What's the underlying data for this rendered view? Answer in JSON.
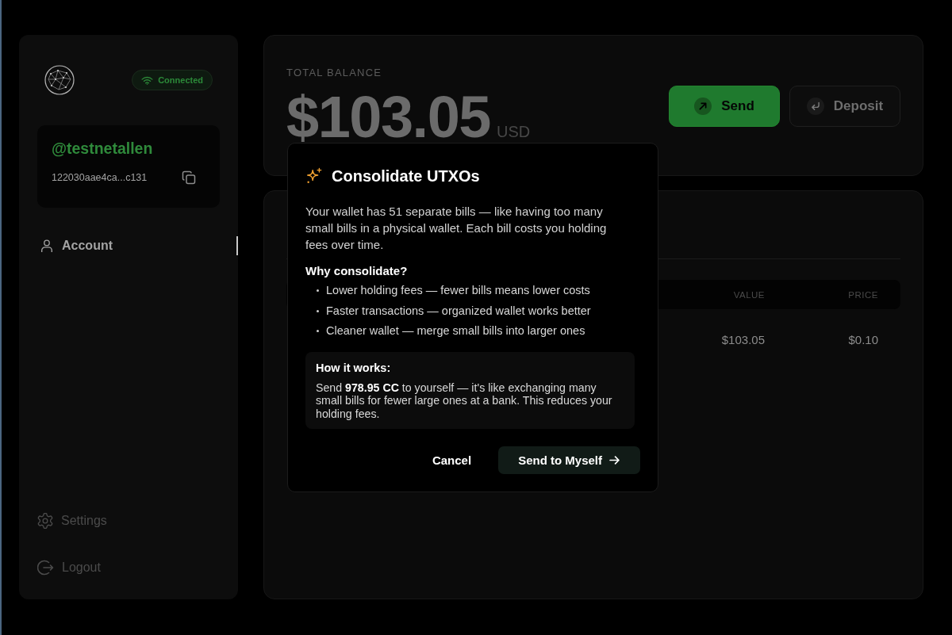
{
  "sidebar": {
    "status_badge": "Connected",
    "account": {
      "handle": "@testnetallen",
      "address": "122030aae4ca...c131"
    },
    "nav": [
      {
        "label": "Account",
        "kind": "account",
        "selected": true
      }
    ],
    "footer_nav": [
      {
        "label": "Settings",
        "kind": "settings",
        "selected": false
      },
      {
        "label": "Logout",
        "kind": "logout",
        "selected": false
      }
    ]
  },
  "balance": {
    "label": "TOTAL BALANCE",
    "amount": "$103.05",
    "currency": "USD"
  },
  "actions": [
    {
      "label": "Send",
      "kind": "send"
    },
    {
      "label": "Deposit",
      "kind": "deposit"
    }
  ],
  "holdings_table": {
    "columns": [
      "VALUE",
      "PRICE"
    ],
    "rows": [
      [
        "$103.05",
        "$0.10"
      ]
    ]
  },
  "dialog": {
    "title": "Consolidate UTXOs",
    "intro": "Your wallet has 51 separate bills — like having too many small bills in a physical wallet. Each bill costs you holding fees over time.",
    "why_heading": "Why consolidate?",
    "reasons": [
      "Lower holding fees — fewer bills means lower costs",
      "Faster transactions — organized wallet works better",
      "Cleaner wallet — merge small bills into larger ones"
    ],
    "how_heading": "How it works:",
    "how_text": "Send **978.95 CC** to yourself — it's like exchanging many small bills for fewer large ones at a bank. This reduces your holding fees.",
    "buttons": [
      {
        "label": "Cancel",
        "kind": "text"
      },
      {
        "label": "Send to Myself",
        "kind": "primary"
      }
    ]
  }
}
